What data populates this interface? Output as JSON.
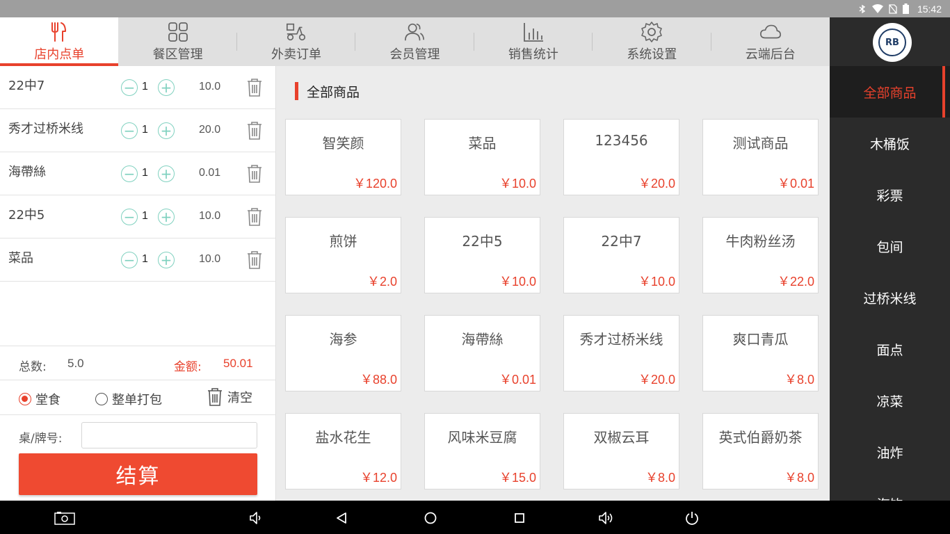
{
  "status_bar": {
    "time": "15:42",
    "icons": [
      "bluetooth-icon",
      "wifi-icon",
      "no-sim-icon",
      "battery-icon"
    ]
  },
  "tabs": [
    {
      "label": "店内点单",
      "icon": "fork-knife-icon",
      "active": true
    },
    {
      "label": "餐区管理",
      "icon": "grid-icon",
      "active": false
    },
    {
      "label": "外卖订单",
      "icon": "scooter-icon",
      "active": false
    },
    {
      "label": "会员管理",
      "icon": "members-icon",
      "active": false
    },
    {
      "label": "销售统计",
      "icon": "bar-chart-icon",
      "active": false
    },
    {
      "label": "系统设置",
      "icon": "gear-icon",
      "active": false
    },
    {
      "label": "云端后台",
      "icon": "cloud-icon",
      "active": false
    }
  ],
  "order": {
    "items": [
      {
        "name": "22中7",
        "qty": "1",
        "price": "10.0"
      },
      {
        "name": "秀才过桥米线",
        "qty": "1",
        "price": "20.0"
      },
      {
        "name": "海帶絲",
        "qty": "1",
        "price": "0.01"
      },
      {
        "name": "22中5",
        "qty": "1",
        "price": "10.0"
      },
      {
        "name": "菜品",
        "qty": "1",
        "price": "10.0"
      }
    ],
    "total_count_label": "总数:",
    "total_count": "5.0",
    "amount_label": "金额:",
    "amount": "50.01",
    "dine_in_label": "堂食",
    "takeaway_label": "整单打包",
    "clear_label": "清空",
    "table_label": "桌/牌号:",
    "table_value": "",
    "checkout_label": "结算"
  },
  "main": {
    "section_title": "全部商品",
    "products": [
      {
        "name": "智笑颜",
        "price": "￥120.0"
      },
      {
        "name": "菜品",
        "price": "￥10.0"
      },
      {
        "name": "123456",
        "price": "￥20.0"
      },
      {
        "name": "测试商品",
        "price": "￥0.01"
      },
      {
        "name": "煎饼",
        "price": "￥2.0"
      },
      {
        "name": "22中5",
        "price": "￥10.0"
      },
      {
        "name": "22中7",
        "price": "￥10.0"
      },
      {
        "name": "牛肉粉丝汤",
        "price": "￥22.0"
      },
      {
        "name": "海参",
        "price": "￥88.0"
      },
      {
        "name": "海帶絲",
        "price": "￥0.01"
      },
      {
        "name": "秀才过桥米线",
        "price": "￥20.0"
      },
      {
        "name": "爽口青瓜",
        "price": "￥8.0"
      },
      {
        "name": "盐水花生",
        "price": "￥12.0"
      },
      {
        "name": "风味米豆腐",
        "price": "￥15.0"
      },
      {
        "name": "双椒云耳",
        "price": "￥8.0"
      },
      {
        "name": "英式伯爵奶茶",
        "price": "￥8.0"
      }
    ]
  },
  "categories": [
    {
      "label": "全部商品",
      "active": true
    },
    {
      "label": "木桶饭",
      "active": false
    },
    {
      "label": "彩票",
      "active": false
    },
    {
      "label": "包间",
      "active": false
    },
    {
      "label": "过桥米线",
      "active": false
    },
    {
      "label": "面点",
      "active": false
    },
    {
      "label": "凉菜",
      "active": false
    },
    {
      "label": "油炸",
      "active": false
    },
    {
      "label": "汽饮",
      "active": false
    }
  ],
  "logo": {
    "text": "RB"
  },
  "navbar_icons": [
    "screenshot-icon",
    "volume-down-icon",
    "back-icon",
    "home-icon",
    "recents-icon",
    "volume-up-icon",
    "power-icon"
  ],
  "colors": {
    "accent": "#e8412c",
    "sidebar_bg": "#2b2b2b",
    "stepper": "#7fd1bf"
  }
}
